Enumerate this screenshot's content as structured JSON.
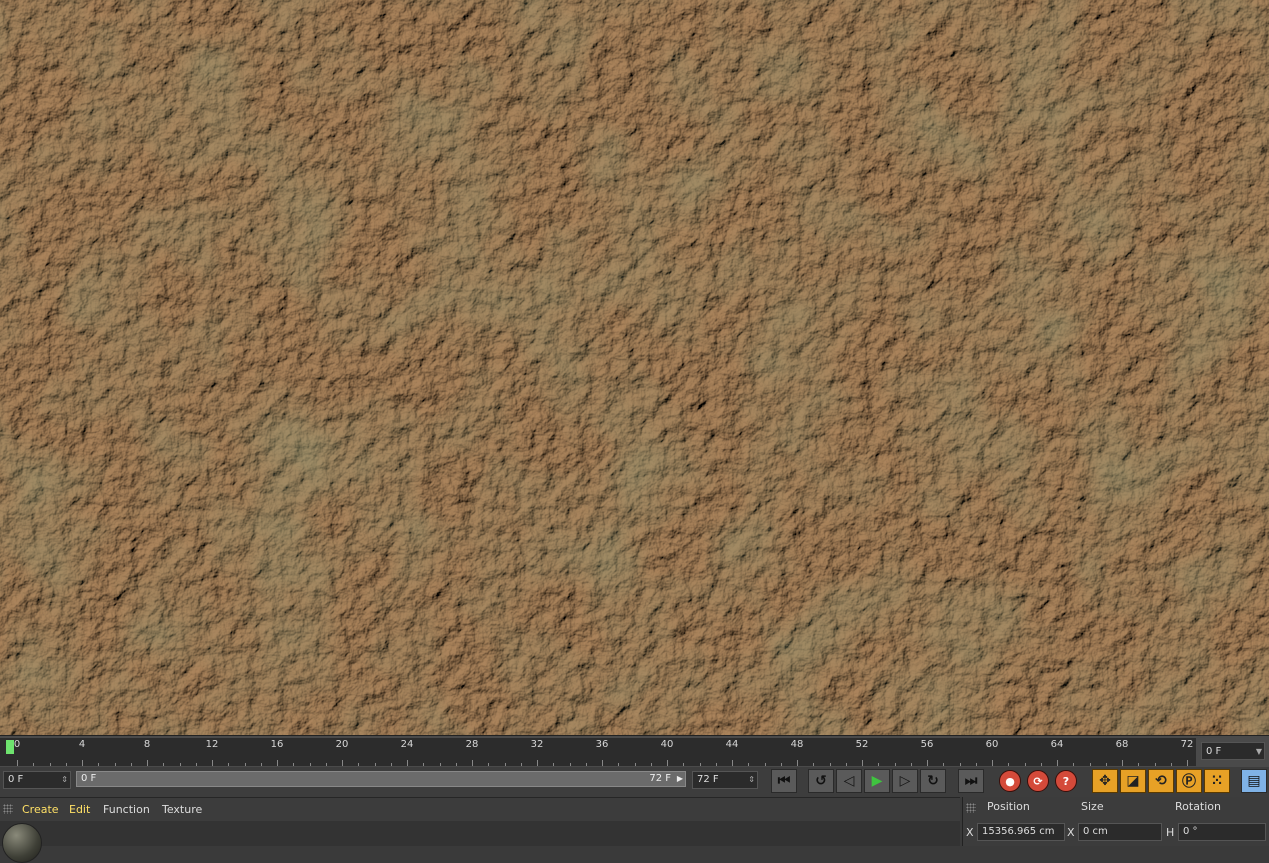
{
  "timeline": {
    "ticks": [
      "0",
      "4",
      "8",
      "12",
      "16",
      "20",
      "24",
      "28",
      "32",
      "36",
      "40",
      "44",
      "48",
      "52",
      "56",
      "60",
      "64",
      "68",
      "72"
    ],
    "current_frame": "0 F"
  },
  "transport": {
    "start_field": "0 F",
    "range_start": "0 F",
    "range_end": "72 F",
    "end_field": "72 F",
    "icons": {
      "goto_start": "skip-to-start-icon",
      "prev_key": "previous-keyframe-icon",
      "step_back": "step-back-icon",
      "play": "play-icon",
      "step_forward": "step-forward-icon",
      "next_key": "next-keyframe-icon",
      "goto_end": "skip-to-end-icon",
      "record": "record-keys-icon",
      "autokey": "auto-keying-icon",
      "keyframe_selection": "keyframe-selection-icon",
      "move": "move-icon",
      "scale": "scale-icon",
      "rotate": "rotate-icon",
      "param": "parameter-icon",
      "pla": "pla-icon",
      "film": "film-icon"
    }
  },
  "material_manager": {
    "menu": [
      "Create",
      "Edit",
      "Function",
      "Texture"
    ]
  },
  "coordinates": {
    "headers": [
      "Position",
      "Size",
      "Rotation"
    ],
    "row1": {
      "pos_axis": "X",
      "pos_value": "15356.965 cm",
      "size_axis": "X",
      "size_value": "0 cm",
      "rot_axis": "H",
      "rot_value": "0 °"
    }
  },
  "colors": {
    "playhead": "#6ee36e",
    "record_red": "#d44a3a",
    "tool_orange": "#e7a126",
    "menu_highlight": "#ffe066"
  }
}
